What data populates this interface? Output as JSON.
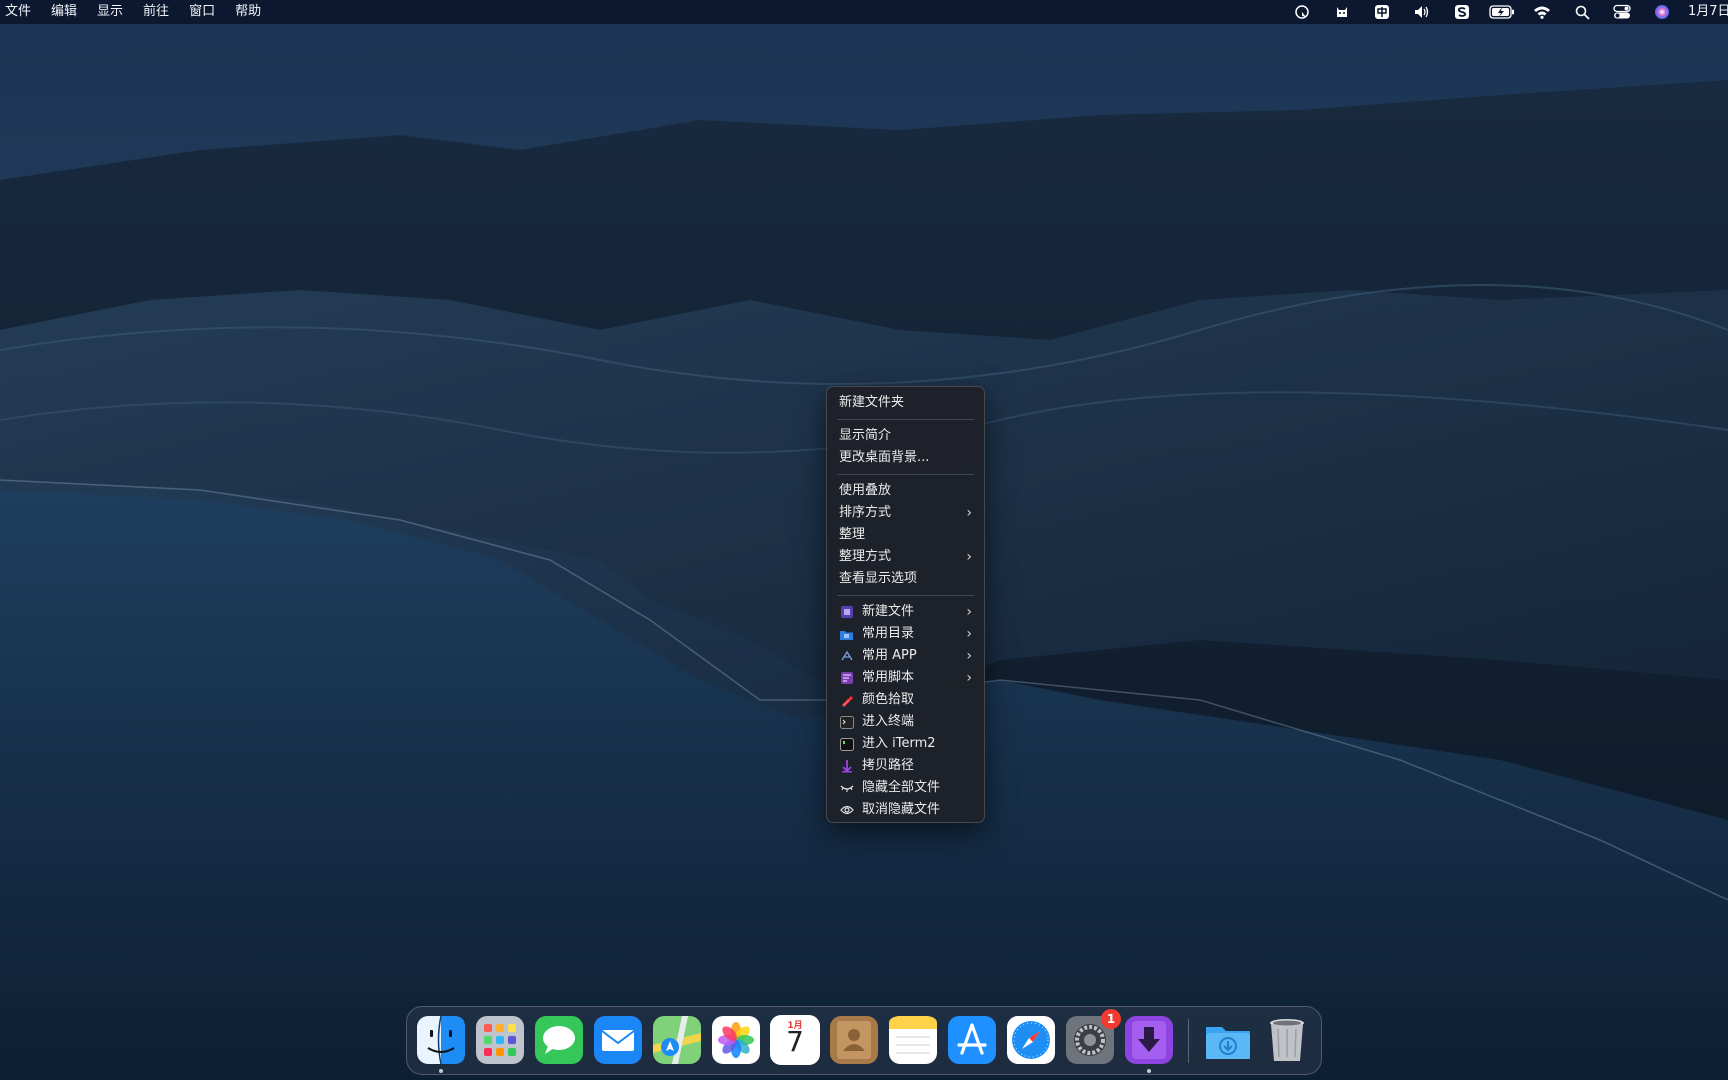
{
  "menubar": {
    "items": [
      "文件",
      "编辑",
      "显示",
      "前往",
      "窗口",
      "帮助"
    ],
    "status_icons": [
      "cursor-clock-icon",
      "cat-app-icon",
      "input-method-icon",
      "volume-icon",
      "sogou-icon",
      "battery-charging-icon",
      "wifi-icon",
      "search-icon",
      "control-center-icon",
      "siri-icon"
    ],
    "clock": "1月7日"
  },
  "context_menu": {
    "items": [
      {
        "label": "新建文件夹",
        "has_submenu": false
      },
      {
        "separator": true
      },
      {
        "label": "显示简介",
        "has_submenu": false
      },
      {
        "label": "更改桌面背景...",
        "has_submenu": false
      },
      {
        "separator": true
      },
      {
        "label": "使用叠放",
        "has_submenu": false
      },
      {
        "label": "排序方式",
        "has_submenu": true
      },
      {
        "label": "整理",
        "has_submenu": false
      },
      {
        "label": "整理方式",
        "has_submenu": true
      },
      {
        "label": "查看显示选项",
        "has_submenu": false
      },
      {
        "separator": true
      },
      {
        "label": "新建文件",
        "icon": "new-file-icon",
        "has_submenu": true
      },
      {
        "label": "常用目录",
        "icon": "folder-icon",
        "has_submenu": true
      },
      {
        "label": "常用 APP",
        "icon": "app-icon",
        "has_submenu": true
      },
      {
        "label": "常用脚本",
        "icon": "script-icon",
        "has_submenu": true
      },
      {
        "label": "颜色拾取",
        "icon": "eyedropper-icon",
        "has_submenu": false
      },
      {
        "label": "进入终端",
        "icon": "terminal-icon",
        "has_submenu": false
      },
      {
        "label": "进入 iTerm2",
        "icon": "iterm-icon",
        "has_submenu": false
      },
      {
        "label": "拷贝路径",
        "icon": "copy-path-icon",
        "has_submenu": false
      },
      {
        "label": "隐藏全部文件",
        "icon": "eye-closed-icon",
        "has_submenu": false
      },
      {
        "label": "取消隐藏文件",
        "icon": "eye-icon",
        "has_submenu": false
      }
    ]
  },
  "dock": {
    "apps": [
      {
        "name": "finder-icon",
        "running": true
      },
      {
        "name": "launchpad-icon"
      },
      {
        "name": "messages-icon"
      },
      {
        "name": "mail-icon"
      },
      {
        "name": "maps-icon"
      },
      {
        "name": "photos-icon"
      },
      {
        "name": "calendar-icon",
        "month": "1月",
        "day": "7"
      },
      {
        "name": "contacts-icon"
      },
      {
        "name": "notes-icon"
      },
      {
        "name": "app-store-icon"
      },
      {
        "name": "safari-icon"
      },
      {
        "name": "system-settings-icon",
        "badge": "1"
      },
      {
        "name": "downie-icon",
        "running": true
      },
      {
        "name": "downloads-folder-icon"
      },
      {
        "name": "trash-icon"
      }
    ]
  },
  "colors": {
    "menubar_bg": "#0a162d",
    "menu_bg": "#1e2128",
    "badge": "#f23b30",
    "accent_blue": "#1d8cf5"
  }
}
